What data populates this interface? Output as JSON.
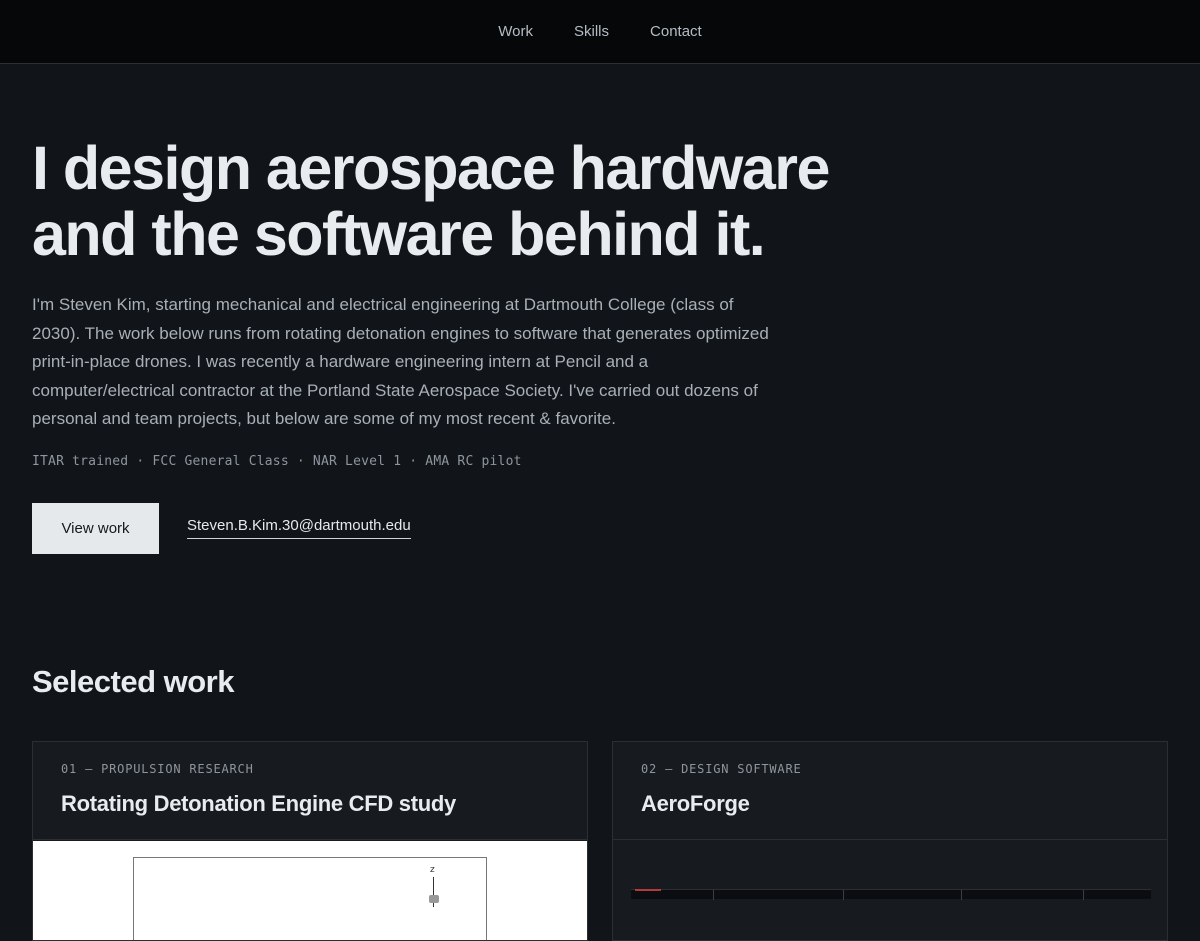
{
  "nav": {
    "items": [
      {
        "label": "Work"
      },
      {
        "label": "Skills"
      },
      {
        "label": "Contact"
      }
    ]
  },
  "hero": {
    "title_line1": "I design aerospace hardware",
    "title_line2": "and the software behind it.",
    "intro": "I'm Steven Kim, starting mechanical and electrical engineering at Dartmouth College (class of 2030). The work below runs from rotating detonation engines to software that generates optimized print-in-place drones. I was recently a hardware engineering intern at Pencil and a computer/electrical contractor at the Portland State Aerospace Society. I've carried out dozens of personal and team projects, but below are some of my most recent & favorite.",
    "certs": "ITAR trained · FCC General Class · NAR Level 1 · AMA RC pilot",
    "cta_label": "View work",
    "email": "Steven.B.Kim.30@dartmouth.edu"
  },
  "selected_work": {
    "heading": "Selected work",
    "cards": [
      {
        "kicker": "01 — PROPULSION RESEARCH",
        "title": "Rotating Detonation Engine CFD study",
        "axis_label": "z"
      },
      {
        "kicker": "02 — DESIGN SOFTWARE",
        "title": "AeroForge"
      }
    ]
  },
  "colors": {
    "background": "#111418",
    "nav_background": "#050709",
    "button_background": "#e6e9ec",
    "card_background": "#171b20"
  }
}
